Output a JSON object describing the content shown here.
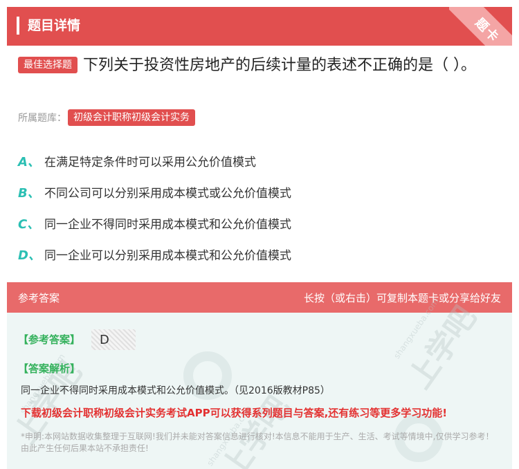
{
  "header": {
    "title": "题目详情",
    "corner_label": "题卡"
  },
  "question": {
    "type_tag": "最佳选择题",
    "text": "下列关于投资性房地产的后续计量的表述不正确的是（ ）。",
    "source_label": "所属题库：",
    "source_tag": "初级会计职称初级会计实务"
  },
  "options": [
    {
      "letter": "A、",
      "text": "在满足特定条件时可以采用公允价值模式"
    },
    {
      "letter": "B、",
      "text": "不同公司可以分别采用成本模式或公允价值模式"
    },
    {
      "letter": "C、",
      "text": "同一企业不得同时采用成本模式和公允价值模式"
    },
    {
      "letter": "D、",
      "text": "同一企业可以分别采用成本模式和公允价值模式"
    }
  ],
  "answer": {
    "panel_title": "参考答案",
    "share_hint": "长按（或右击）可复制本题卡或分享给好友",
    "answer_label": "【参考答案】",
    "answer_value": "D",
    "explain_label": "【答案解析】",
    "explain_text": "同一企业不得同时采用成本模式和公允价值模式。（见2016版教材P85）",
    "promo_text": "下载初级会计职称初级会计实务考试APP可以获得系列题目与答案,还有练习等更多学习功能!",
    "disclaimer": "*申明:本网站数据收集整理于互联网!我们并未能对答案信息进行核对!本信息不能用于生产、生活、考试等情境中,仅供学习参考！由此产生任何后果本站不承担责任!"
  },
  "watermark": {
    "text": "上学吧",
    "site": "shangxueba.com"
  },
  "colors": {
    "accent_red": "#e14f4f",
    "teal": "#2bbfb3",
    "green": "#34b15c",
    "promo_red": "#e33131"
  }
}
